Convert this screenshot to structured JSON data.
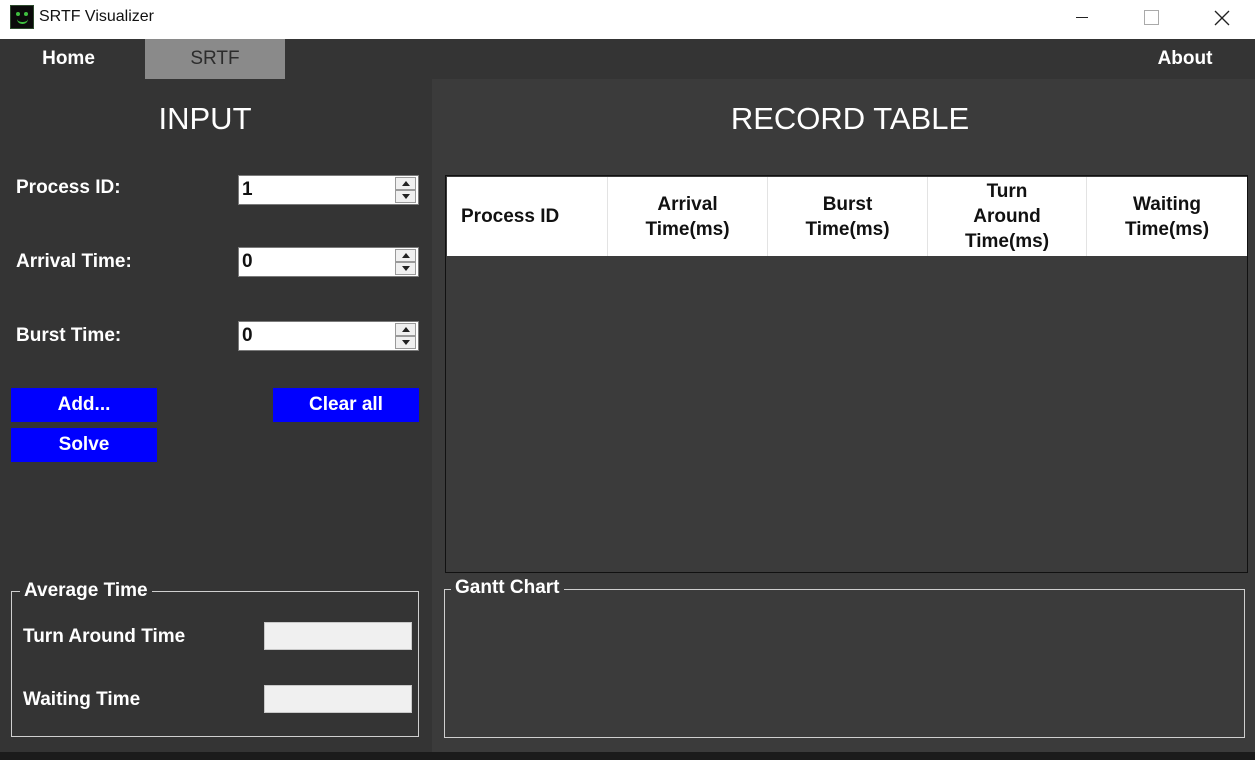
{
  "window": {
    "title": "SRTF Visualizer",
    "controls": {
      "minimize": "",
      "maximize": "",
      "close": "✕"
    }
  },
  "menu": {
    "tabs": [
      {
        "label": "Home",
        "active": false
      },
      {
        "label": "SRTF",
        "active": true
      },
      {
        "label": "About",
        "active": false
      }
    ]
  },
  "input": {
    "title": "INPUT",
    "fields": [
      {
        "label": "Process ID:",
        "value": "1"
      },
      {
        "label": "Arrival Time:",
        "value": "0"
      },
      {
        "label": "Burst Time:",
        "value": "0"
      }
    ],
    "buttons": {
      "add": "Add...",
      "clear": "Clear all",
      "solve": "Solve"
    }
  },
  "average": {
    "title": "Average Time",
    "turnaround_label": "Turn Around Time",
    "turnaround_value": "",
    "waiting_label": "Waiting Time",
    "waiting_value": ""
  },
  "record_table": {
    "title": "RECORD TABLE",
    "columns": [
      "Process ID",
      "Arrival Time(ms)",
      "Burst Time(ms)",
      "Turn Around Time(ms)",
      "Waiting Time(ms)"
    ],
    "rows": []
  },
  "gantt": {
    "title": "Gantt Chart"
  },
  "colors": {
    "button_bg": "#0000ff",
    "panel_bg": "#343434",
    "active_tab_bg": "#8a8a8a"
  }
}
